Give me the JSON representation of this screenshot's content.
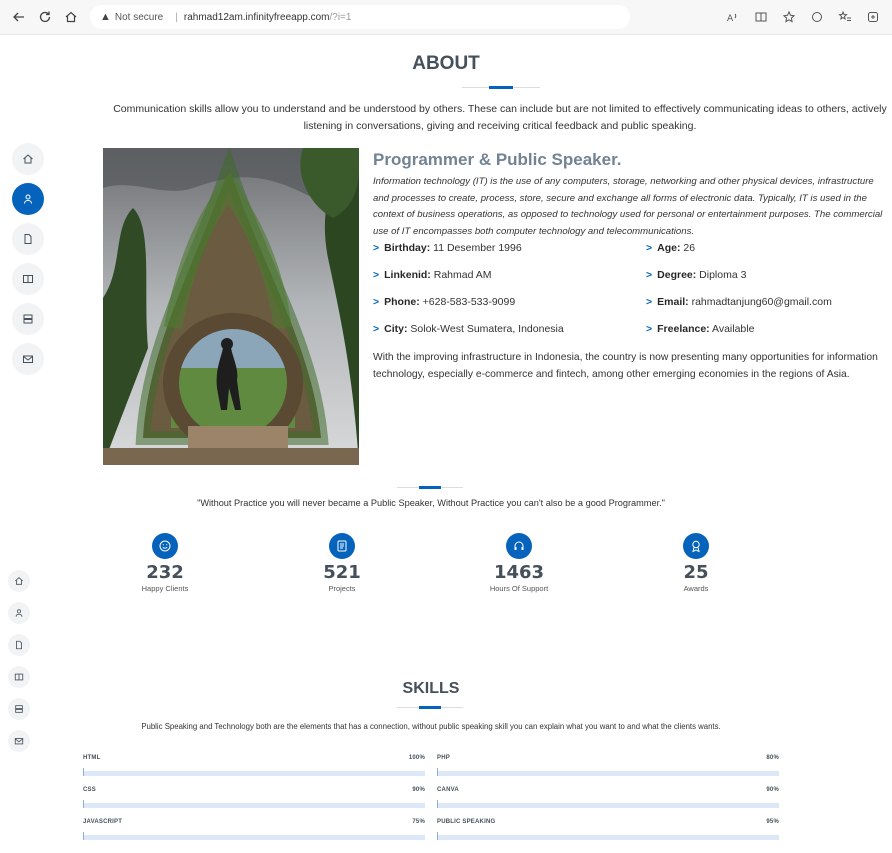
{
  "browser": {
    "warning_label": "Not secure",
    "url_host": "rahmad12am.infinityfreeapp.com",
    "url_path": "/?i=1"
  },
  "about": {
    "title": "ABOUT",
    "intro": "Communication skills allow you to understand and be understood by others. These can include but are not limited to effectively communicating ideas to others, actively listening in conversations, giving and receiving critical feedback and public speaking.",
    "heading": "Programmer & Public Speaker.",
    "italic_text": "Information technology (IT) is the use of any computers, storage, networking and other physical devices, infrastructure and processes to create, process, store, secure and exchange all forms of electronic data. Typically, IT is used in the context of business operations, as opposed to technology used for personal or entertainment purposes. The commercial use of IT encompasses both computer technology and telecommunications.",
    "info": [
      {
        "label": "Birthday:",
        "value": "11 Desember 1996"
      },
      {
        "label": "Age:",
        "value": "26"
      },
      {
        "label": "Linkenid:",
        "value": "Rahmad AM"
      },
      {
        "label": "Degree:",
        "value": "Diploma 3"
      },
      {
        "label": "Phone:",
        "value": "+628-583-533-9099"
      },
      {
        "label": "Email:",
        "value": "rahmadtanjung60@gmail.com"
      },
      {
        "label": "City:",
        "value": "Solok-West Sumatera, Indonesia"
      },
      {
        "label": "Freelance:",
        "value": "Available"
      }
    ],
    "after_text": "With the improving infrastructure in Indonesia, the country is now presenting many opportunities for information technology, especially e-commerce and fintech, among other emerging economies in the regions of Asia."
  },
  "quote": "\"Without Practice you will never became a Public Speaker, Without Practice you can't also be a good Programmer.\"",
  "counts": [
    {
      "number": "232",
      "label": "Happy Clients",
      "icon": "emoji-smile-icon"
    },
    {
      "number": "521",
      "label": "Projects",
      "icon": "journal-icon"
    },
    {
      "number": "1463",
      "label": "Hours Of Support",
      "icon": "headset-icon"
    },
    {
      "number": "25",
      "label": "Awards",
      "icon": "award-icon"
    }
  ],
  "skills": {
    "title": "SKILLS",
    "description": "Public Speaking and Technology both are the elements that has a connection, without public speaking skill you can explain what you want to and what the clients wants.",
    "items": [
      {
        "name": "HTML",
        "percent_label": "100%"
      },
      {
        "name": "PHP",
        "percent_label": "80%"
      },
      {
        "name": "CSS",
        "percent_label": "90%"
      },
      {
        "name": "CANVA",
        "percent_label": "90%"
      },
      {
        "name": "JAVASCRIPT",
        "percent_label": "75%"
      },
      {
        "name": "PUBLIC SPEAKING",
        "percent_label": "95%"
      }
    ]
  },
  "colors": {
    "accent": "#0563bb",
    "heading": "#45505b",
    "subheading": "#728394"
  }
}
